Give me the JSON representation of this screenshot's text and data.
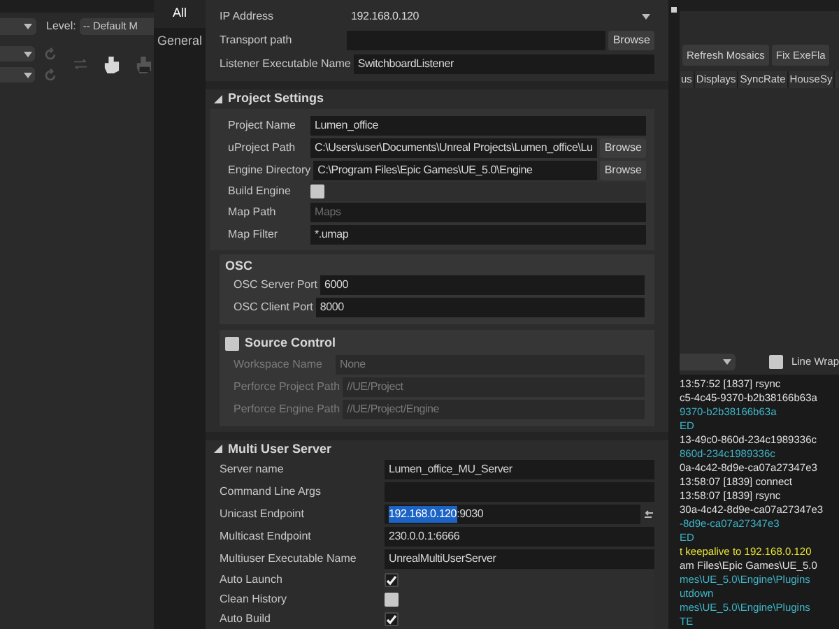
{
  "left_app": {
    "level_label": "Level:",
    "level_value": "-- Default M"
  },
  "dialog": {
    "tabs": [
      {
        "label": "All",
        "selected": true
      },
      {
        "label": "General",
        "selected": false
      }
    ],
    "general": [
      {
        "kind": "dropdown",
        "label": "IP Address",
        "value": "192.168.0.120"
      },
      {
        "kind": "path",
        "label": "Transport path",
        "button": "Browse"
      },
      {
        "kind": "text",
        "label": "Listener Executable Name",
        "value": "SwitchboardListener"
      }
    ],
    "project_settings": {
      "title": "Project Settings",
      "expanded": true,
      "rows": [
        {
          "kind": "text",
          "label": "Project Name",
          "value": "Lumen_office"
        },
        {
          "kind": "path",
          "label": "uProject Path",
          "value": "C:\\Users\\user\\Documents\\Unreal Projects\\Lumen_office\\Lu",
          "button": "Browse"
        },
        {
          "kind": "path",
          "label": "Engine Directory",
          "value": "C:\\Program Files\\Epic Games\\UE_5.0\\Engine",
          "button": "Browse"
        },
        {
          "kind": "checkbox",
          "label": "Build Engine",
          "checked": false
        },
        {
          "kind": "placeholder",
          "label": "Map Path",
          "placeholder": "Maps"
        },
        {
          "kind": "text",
          "label": "Map Filter",
          "value": "*.umap"
        }
      ],
      "osc": {
        "title": "OSC",
        "rows": [
          {
            "kind": "text",
            "label": "OSC Server Port",
            "value": "6000"
          },
          {
            "kind": "text",
            "label": "OSC Client Port",
            "value": "8000"
          }
        ]
      },
      "source_control": {
        "title": "Source Control",
        "checked": false,
        "rows": [
          {
            "kind": "text",
            "label": "Workspace Name",
            "value": "None",
            "disabled": true
          },
          {
            "kind": "text",
            "label": "Perforce Project Path",
            "value": "//UE/Project",
            "disabled": true
          },
          {
            "kind": "text",
            "label": "Perforce Engine Path",
            "value": "//UE/Project/Engine",
            "disabled": true
          }
        ]
      }
    },
    "multi_user_server": {
      "title": "Multi User Server",
      "expanded": true,
      "rows": [
        {
          "kind": "text",
          "label": "Server name",
          "value": "Lumen_office_MU_Server"
        },
        {
          "kind": "text",
          "label": "Command Line Args"
        },
        {
          "kind": "endpoint",
          "label": "Unicast Endpoint",
          "selected_part": "192.168.0.120",
          "rest": ":9030"
        },
        {
          "kind": "text",
          "label": "Multicast Endpoint",
          "value": "230.0.0.1:6666"
        },
        {
          "kind": "text",
          "label": "Multiuser Executable Name",
          "value": "UnrealMultiUserServer"
        },
        {
          "kind": "checkbox",
          "label": "Auto Launch",
          "checked": true
        },
        {
          "kind": "checkbox",
          "label": "Clean History",
          "checked": false
        },
        {
          "kind": "checkbox",
          "label": "Auto Build",
          "checked": true
        }
      ]
    }
  },
  "right_app": {
    "buttons": [
      "Refresh Mosaics",
      "Fix ExeFla"
    ],
    "columns": [
      "us",
      "Displays",
      "SyncRate",
      "HouseSy"
    ],
    "line_wrap": {
      "label": "Line Wrap",
      "checked": false
    },
    "log": [
      {
        "kind": "info",
        "text": "13:57:52 [1837] rsync"
      },
      {
        "kind": "info",
        "text": "c5-4c45-9370-b2b38166b63a"
      },
      {
        "kind": "device",
        "text": "9370-b2b38166b63a"
      },
      {
        "kind": "device",
        "text": "ED"
      },
      {
        "kind": "info",
        "text": "13-49c0-860d-234c1989336c"
      },
      {
        "kind": "device",
        "text": "860d-234c1989336c"
      },
      {
        "kind": "info",
        "text": "0a-4c42-8d9e-ca07a27347e3"
      },
      {
        "kind": "info",
        "text": "13:58:07 [1839] connect"
      },
      {
        "kind": "info",
        "text": "13:58:07 [1839] rsync"
      },
      {
        "kind": "info",
        "text": "30a-4c42-8d9e-ca07a27347e3"
      },
      {
        "kind": "device",
        "text": "-8d9e-ca07a27347e3"
      },
      {
        "kind": "device",
        "text": "ED"
      },
      {
        "kind": "warning",
        "text": "t keepalive to 192.168.0.120"
      },
      {
        "kind": "info",
        "text": "am Files\\Epic Games\\UE_5.0"
      },
      {
        "kind": "device",
        "text": "mes\\UE_5.0\\Engine\\Plugins"
      },
      {
        "kind": "device",
        "text": "utdown"
      },
      {
        "kind": "device",
        "text": "mes\\UE_5.0\\Engine\\Plugins"
      },
      {
        "kind": "device",
        "text": "TE"
      }
    ]
  }
}
